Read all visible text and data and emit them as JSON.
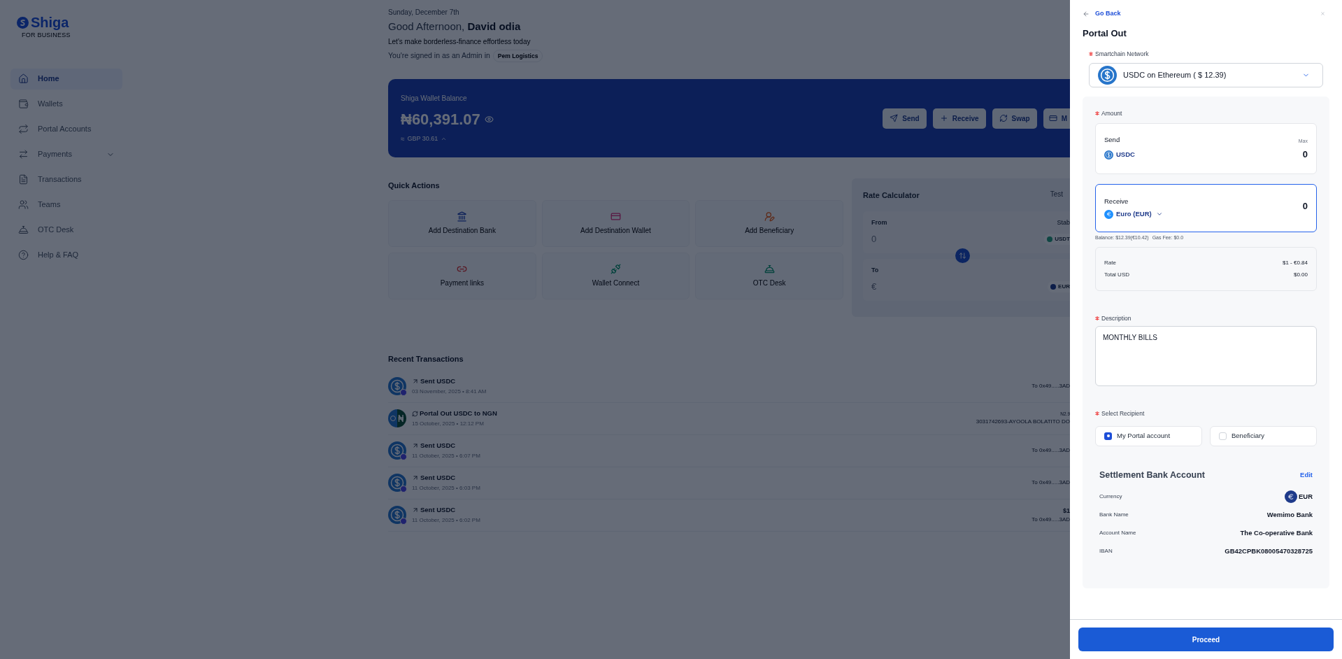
{
  "sidebar": {
    "logo": {
      "name": "Shiga",
      "tagline": "FOR BUSINESS"
    },
    "items": [
      {
        "label": "Home",
        "selected": true,
        "kind": "link"
      },
      {
        "label": "Wallets",
        "selected": false,
        "kind": "link"
      },
      {
        "label": "Portal Accounts",
        "selected": false,
        "kind": "link"
      },
      {
        "label": "Payments",
        "selected": false,
        "kind": "group"
      },
      {
        "label": "Transactions",
        "selected": false,
        "kind": "link"
      },
      {
        "label": "Teams",
        "selected": false,
        "kind": "link"
      },
      {
        "label": "OTC Desk",
        "selected": false,
        "kind": "link"
      },
      {
        "label": "Help & FAQ",
        "selected": false,
        "kind": "link"
      }
    ]
  },
  "header": {
    "date": "Sunday, December 7th",
    "greeting": "Good Afternoon,",
    "user_name": "David odia",
    "subtitle": "Let's make borderless-finance effortless today",
    "signed_in": "You're signed in as an Admin in",
    "organization": "Pem Logistics"
  },
  "wallet": {
    "label": "Shiga Wallet Balance",
    "balance": "₦60,391.07",
    "approx": "≈",
    "equivalent": "GBP 30.61",
    "actions": [
      {
        "label": "Send",
        "kind": "send"
      },
      {
        "label": "Receive",
        "kind": "receive"
      },
      {
        "label": "Swap",
        "kind": "swap"
      },
      {
        "label": "M",
        "kind": "manage"
      }
    ]
  },
  "quick_actions": {
    "title": "Quick Actions",
    "items": [
      "Add Destination Bank",
      "Add Destination Wallet",
      "Add Beneficiary",
      "Payment links",
      "Wallet Connect",
      "OTC Desk"
    ]
  },
  "rate_calculator": {
    "title": "Rate Calculator",
    "tab": "Test",
    "from": {
      "label": "From",
      "placeholder": "0",
      "hint": "Stab",
      "currency": "USDT"
    },
    "to": {
      "label": "To",
      "placeholder": "€",
      "currency": "EUR"
    }
  },
  "recent_transactions": {
    "title": "Recent Transactions",
    "items": [
      {
        "title": "Sent USDC",
        "kind": "sent",
        "time": "03 November, 2025 • 8:41 AM",
        "detail": "To 0x49.....3AD"
      },
      {
        "title": "Portal Out USDC to NGN",
        "kind": "swap",
        "time": "15 October, 2025 • 12:12 PM",
        "amount": "N2.9",
        "detail": "3031742693-AYOOLA BOLATITO DO"
      },
      {
        "title": "Sent USDC",
        "kind": "sent",
        "time": "11 October, 2025 • 6:07 PM",
        "detail": "To 0x49.....3AD"
      },
      {
        "title": "Sent USDC",
        "kind": "sent",
        "time": "11 October, 2025 • 6:03 PM",
        "detail": "To 0x49.....3AD"
      },
      {
        "title": "Sent USDC",
        "kind": "sent",
        "time": "11 October, 2025 • 6:02 PM",
        "amount": "$1",
        "detail": "To 0x49.....3AD"
      }
    ]
  },
  "portal_out": {
    "back": "Go Back",
    "title": "Portal Out",
    "network": {
      "label": "Smartchain Network",
      "required": true,
      "value": "USDC on Ethereum ( $ 12.39)"
    },
    "amount": {
      "label": "Amount",
      "required": true,
      "send": {
        "label": "Send",
        "max": "Max",
        "currency": "USDC",
        "value": "0",
        "focused": false
      },
      "receive": {
        "label": "Receive",
        "currency": "Euro (EUR)",
        "value": "0",
        "focused": true
      }
    },
    "balance_note": "Balance: $12.39(€10.42)",
    "gas_fee": "Gas Fee: $0.0",
    "summary": [
      {
        "label": "Rate",
        "value": "$1 - €0.84"
      },
      {
        "label": "Total USD",
        "value": "$0.00"
      }
    ],
    "description": {
      "label": "Description",
      "required": true,
      "value": "MONTHLY BILLS"
    },
    "recipient": {
      "label": "Select Recipient",
      "required": true,
      "options": [
        {
          "label": "My Portal account",
          "selected": true
        },
        {
          "label": "Beneficiary",
          "selected": false
        }
      ]
    },
    "settlement": {
      "title": "Settlement Bank Account",
      "edit": "Edit",
      "rows": [
        {
          "label": "Currency",
          "value": "EUR",
          "kind": "currency"
        },
        {
          "label": "Bank Name",
          "value": "Wemimo Bank",
          "kind": "text"
        },
        {
          "label": "Account Name",
          "value": "The Co-operative Bank",
          "kind": "text"
        },
        {
          "label": "IBAN",
          "value": "GB42CPBK08005470328725",
          "kind": "text"
        }
      ]
    },
    "proceed": "Proceed"
  }
}
